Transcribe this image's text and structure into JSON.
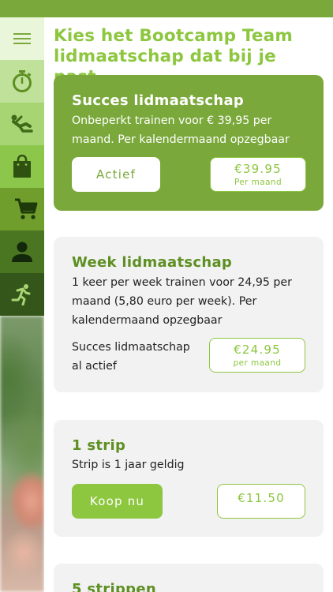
{
  "page": {
    "title": "Kies het Bootcamp Team lidmaatschap dat bij je past"
  },
  "sidebar": {
    "items": [
      {
        "icon": "menu-icon"
      },
      {
        "icon": "stopwatch-icon"
      },
      {
        "icon": "workout-icon"
      },
      {
        "icon": "shopping-bag-icon"
      },
      {
        "icon": "cart-icon"
      },
      {
        "icon": "profile-icon"
      },
      {
        "icon": "runner-icon"
      }
    ]
  },
  "memberships": [
    {
      "title": "Succes lidmaatschap",
      "description": "Onbeperkt trainen voor € 39,95 per maand. Per kalendermaand opzegbaar",
      "button_label": "Actief",
      "price": "€39.95",
      "price_note": "Per maand"
    },
    {
      "title": "Week lidmaatschap",
      "description": "1 keer per week trainen voor 24,95 per maand (5,80 euro per week). Per kalendermaand opzegbaar",
      "status_text": "Succes lidmaatschap al actief",
      "price": "€24.95",
      "price_note": "per maand"
    },
    {
      "title": "1 strip",
      "description": "Strip is 1 jaar geldig",
      "button_label": "Koop nu",
      "price": "€11.50"
    },
    {
      "title": "5 strippen"
    }
  ],
  "colors": {
    "brand_green": "#8dc63f",
    "active_card": "#7aa83a",
    "card_background": "#f2f2f2",
    "title_green": "#5d8f22"
  }
}
